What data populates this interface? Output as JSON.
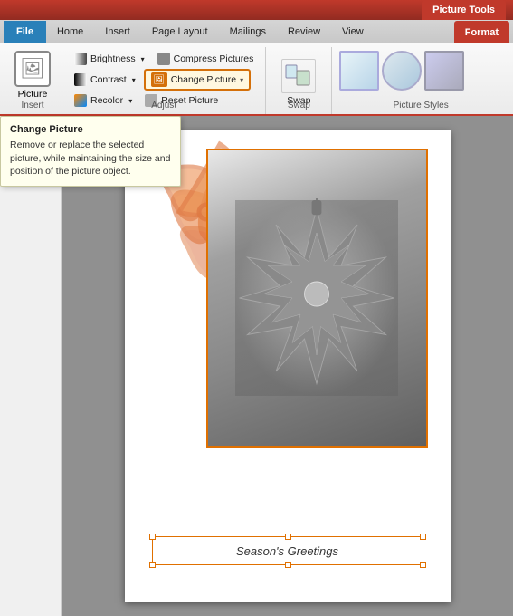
{
  "titlebar": {
    "picture_tools_label": "Picture Tools"
  },
  "tabs": {
    "file": "File",
    "home": "Home",
    "insert": "Insert",
    "page_layout": "Page Layout",
    "mailings": "Mailings",
    "review": "Review",
    "view": "View",
    "format": "Format"
  },
  "ribbon": {
    "insert_group": {
      "label": "Insert",
      "picture_btn": "Picture"
    },
    "adjust_group": {
      "label": "Adjust",
      "brightness_btn": "Brightness",
      "contrast_btn": "Contrast",
      "recolor_btn": "Recolor",
      "compress_btn": "Compress Pictures",
      "change_picture_btn": "Change Picture",
      "reset_picture_btn": "Reset Picture"
    },
    "swap_group": {
      "label": "Swap",
      "swap_btn": "Swap"
    },
    "picture_styles_group": {
      "label": "Picture Styles"
    }
  },
  "tooltip": {
    "title": "Change Picture",
    "body": "Remove or replace the selected picture, while maintaining the size and position of the picture object."
  },
  "canvas": {
    "greeting_text": "Season's Greetings"
  }
}
